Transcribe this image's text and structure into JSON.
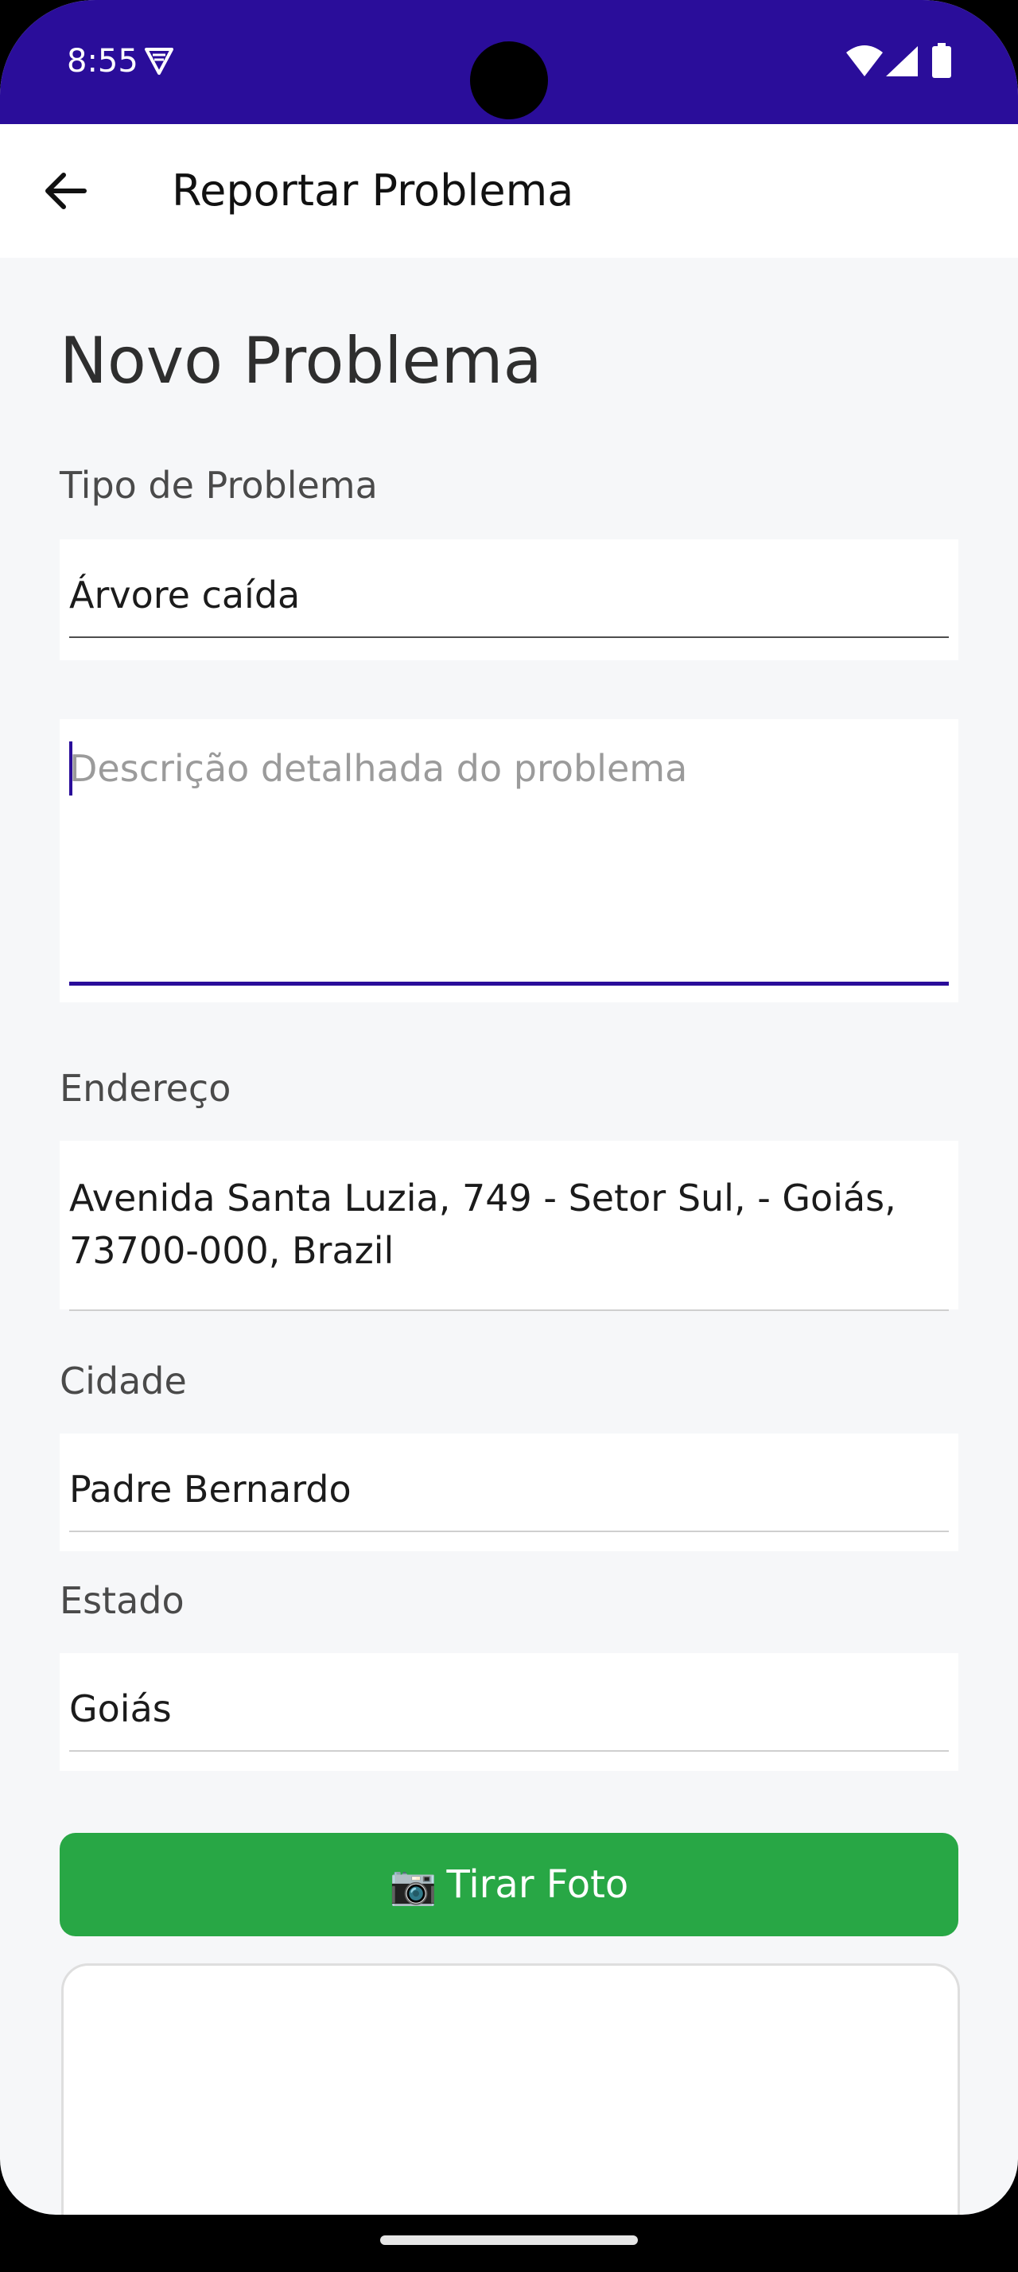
{
  "status_bar": {
    "time": "8:55",
    "icons": [
      "vpn-shield-icon",
      "wifi-icon",
      "cellular-signal-icon",
      "battery-icon"
    ],
    "background": "#2a0d9a"
  },
  "app_bar": {
    "title": "Reportar Problema",
    "back_icon": "arrow-left-icon"
  },
  "form": {
    "heading": "Novo Problema",
    "problem_type": {
      "label": "Tipo de Problema",
      "value": "Árvore caída"
    },
    "description": {
      "placeholder": "Descrição detalhada do problema",
      "value": ""
    },
    "address": {
      "label": "Endereço",
      "line1": "Avenida Santa Luzia, 749 - Setor Sul,  - Goiás,",
      "line2": "73700-000, Brazil"
    },
    "city": {
      "label": "Cidade",
      "value": "Padre Bernardo"
    },
    "state": {
      "label": "Estado",
      "value": "Goiás"
    },
    "photo_button": {
      "icon": "📷",
      "label": "Tirar Foto",
      "color": "#28a745"
    }
  },
  "colors": {
    "accent": "#2a0d9a",
    "background": "#f6f7f9"
  }
}
